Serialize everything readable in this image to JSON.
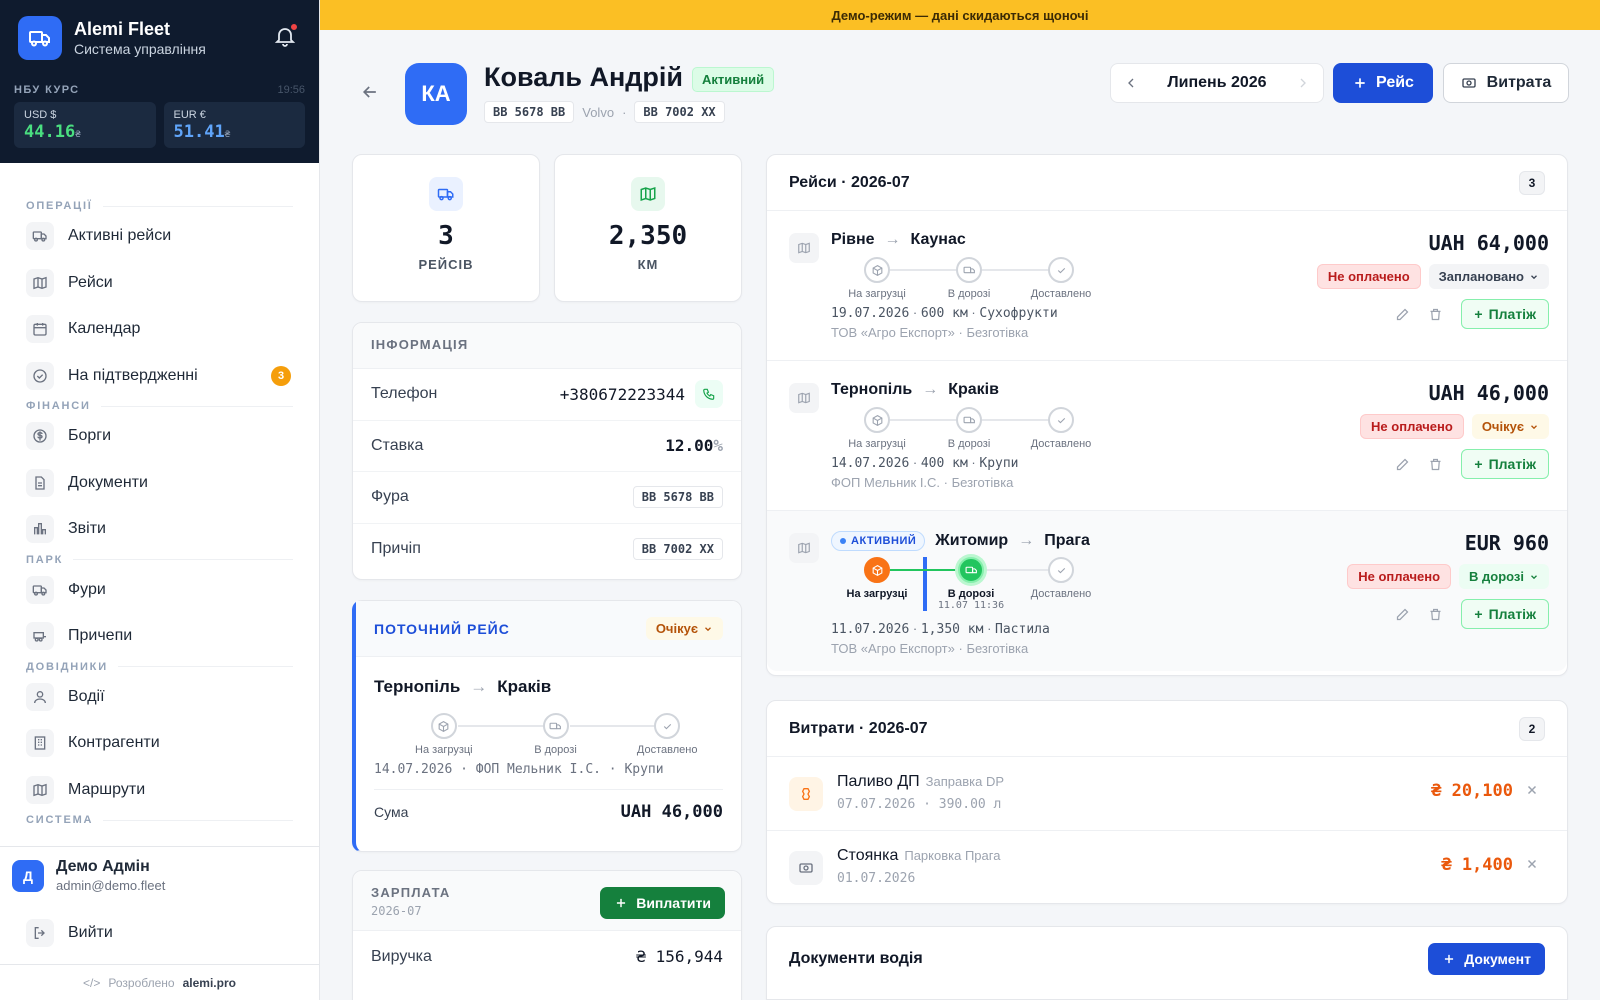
{
  "banner": "Демо-режим — дані скидаються щоночі",
  "brand": {
    "name": "Alemi Fleet",
    "subtitle": "Система управління"
  },
  "rates": {
    "heading": "НБУ КУРС",
    "time": "19:56",
    "items": [
      {
        "label": "USD $",
        "value": "44.16",
        "symbol": "₴"
      },
      {
        "label": "EUR €",
        "value": "51.41",
        "symbol": "₴"
      }
    ]
  },
  "nav": {
    "sections": [
      {
        "title": "ОПЕРАЦІЇ",
        "items": [
          {
            "label": "Активні рейси",
            "icon": "truck-icon"
          },
          {
            "label": "Рейси",
            "icon": "map-icon"
          },
          {
            "label": "Календар",
            "icon": "calendar-icon"
          },
          {
            "label": "На підтвердженні",
            "icon": "check-circle-icon",
            "badge": "3"
          }
        ]
      },
      {
        "title": "ФІНАНСИ",
        "items": [
          {
            "label": "Борги",
            "icon": "dollar-icon"
          },
          {
            "label": "Документи",
            "icon": "document-icon"
          },
          {
            "label": "Звіти",
            "icon": "chart-icon"
          }
        ]
      },
      {
        "title": "ПАРК",
        "items": [
          {
            "label": "Фури",
            "icon": "truck-icon"
          },
          {
            "label": "Причепи",
            "icon": "trailer-icon"
          }
        ]
      },
      {
        "title": "ДОВІДНИКИ",
        "items": [
          {
            "label": "Водії",
            "icon": "user-icon"
          },
          {
            "label": "Контрагенти",
            "icon": "building-icon"
          },
          {
            "label": "Маршрути",
            "icon": "map-icon"
          }
        ]
      },
      {
        "title": "СИСТЕМА",
        "items": []
      }
    ]
  },
  "user": {
    "initial": "Д",
    "name": "Демо Адмін",
    "email": "admin@demo.fleet",
    "logout": "Вийти"
  },
  "footer": {
    "prefix": "Розроблено",
    "link": "alemi.pro"
  },
  "driver": {
    "initials": "КА",
    "name": "Коваль Андрій",
    "status": "Активний",
    "truck_plate": "BB 5678 BB",
    "truck_brand": "Volvo",
    "trailer_plate": "BB 7002 XX"
  },
  "toolbar": {
    "month": "Липень 2026",
    "trip_button": "Рейс",
    "expense_button": "Витрата"
  },
  "stats": [
    {
      "value": "3",
      "label": "РЕЙСІВ",
      "icon": "truck-icon"
    },
    {
      "value": "2,350",
      "label": "КМ",
      "icon": "map-icon"
    }
  ],
  "info": {
    "title": "ІНФОРМАЦІЯ",
    "rows": [
      {
        "label": "Телефон",
        "value": "+380672223344"
      },
      {
        "label": "Ставка",
        "value": "12.00",
        "suffix": "%"
      },
      {
        "label": "Фура",
        "value": "BB 5678 BB"
      },
      {
        "label": "Причіп",
        "value": "BB 7002 XX"
      }
    ]
  },
  "current_trip": {
    "title": "ПОТОЧНИЙ РЕЙС",
    "status": "Очікує",
    "from": "Тернопіль",
    "to": "Краків",
    "steps": [
      "На загрузці",
      "В дорозі",
      "Доставлено"
    ],
    "meta": "14.07.2026 · ФОП Мельник І.С. · Крупи",
    "sum_label": "Сума",
    "sum_value": "UAH 46,000"
  },
  "salary": {
    "title": "ЗАРПЛАТА",
    "period": "2026-07",
    "button": "Виплатити",
    "revenue_label": "Виручка",
    "revenue_value": "₴ 156,944"
  },
  "trips": {
    "title": "Рейси · 2026-07",
    "count": "3",
    "items": [
      {
        "from": "Рівне",
        "to": "Каунас",
        "amount": "UAH 64,000",
        "payment": "Не оплачено",
        "status": "Заплановано",
        "date": "19.07.2026",
        "km": "600 км",
        "cargo": "Сухофрукти",
        "client": "ТОВ «Агро Експорт»",
        "pay_type": "Безготівка",
        "steps": [
          "На загрузці",
          "В дорозі",
          "Доставлено"
        ],
        "pay_button": "Платіж"
      },
      {
        "from": "Тернопіль",
        "to": "Краків",
        "amount": "UAH 46,000",
        "payment": "Не оплачено",
        "status": "Очікує",
        "date": "14.07.2026",
        "km": "400 км",
        "cargo": "Крупи",
        "client": "ФОП Мельник І.С.",
        "pay_type": "Безготівка",
        "steps": [
          "На загрузці",
          "В дорозі",
          "Доставлено"
        ],
        "pay_button": "Платіж"
      },
      {
        "tag": "АКТИВНИЙ",
        "from": "Житомир",
        "to": "Прага",
        "amount": "EUR 960",
        "payment": "Не оплачено",
        "status": "В дорозі",
        "date": "11.07.2026",
        "km": "1,350 км",
        "cargo": "Пастила",
        "client": "ТОВ «Агро Експорт»",
        "pay_type": "Безготівка",
        "steps": [
          "На загрузці",
          "В дорозі",
          "Доставлено"
        ],
        "step_time": "11.07 11:36",
        "pay_button": "Платіж"
      }
    ]
  },
  "expenses": {
    "title": "Витрати · 2026-07",
    "count": "2",
    "items": [
      {
        "name": "Паливо ДП",
        "note": "Заправка DP",
        "date": "07.07.2026",
        "qty": "390.00 л",
        "amount": "₴ 20,100",
        "icon": "fuel-icon"
      },
      {
        "name": "Стоянка",
        "note": "Парковка Прага",
        "date": "01.07.2026",
        "amount": "₴ 1,400",
        "icon": "parking-icon"
      }
    ]
  },
  "documents": {
    "title": "Документи водія",
    "button": "Документ"
  },
  "colors": {
    "primary": "#1d4ed8",
    "accent": "#2f6cf5",
    "banner": "#fbbf24",
    "success": "#15803d",
    "danger": "#b91c1c",
    "warning": "#f59e0b"
  }
}
